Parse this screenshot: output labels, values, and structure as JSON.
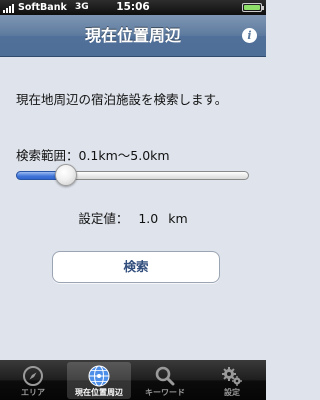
{
  "status_bar": {
    "carrier": "SoftBank",
    "network": "3G",
    "time": "15:06"
  },
  "nav": {
    "title": "現在位置周辺",
    "info_glyph": "i"
  },
  "main": {
    "description": "現在地周辺の宿泊施設を検索します。",
    "range_label": "検索範囲：0.1km〜5.0km",
    "slider": {
      "min_km": 0.1,
      "max_km": 5.0,
      "value_km": 1.0
    },
    "setting_label": "設定値：",
    "setting_value": "1.0",
    "setting_unit": "km",
    "search_button": "検索"
  },
  "tabs": [
    {
      "label": "エリア",
      "icon": "compass-icon",
      "active": false
    },
    {
      "label": "現在位置周辺",
      "icon": "location-globe-icon",
      "active": true
    },
    {
      "label": "キーワード",
      "icon": "search-icon",
      "active": false
    },
    {
      "label": "設定",
      "icon": "gear-icon",
      "active": false
    }
  ],
  "colors": {
    "nav_bar": "#5d7a9e",
    "background": "#dfe4ec",
    "slider_fill": "#3f74d8",
    "button_text": "#334f7d"
  }
}
